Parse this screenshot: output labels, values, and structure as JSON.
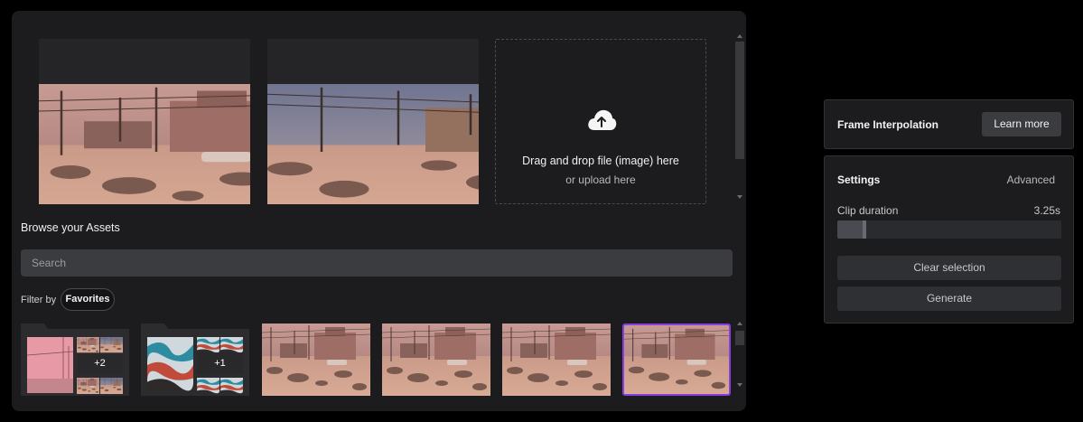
{
  "upload": {
    "title": "Drag and drop file (image) here",
    "subtitle": "or upload here",
    "icon": "cloud-upload-icon"
  },
  "assets": {
    "title": "Browse your Assets",
    "search_placeholder": "Search",
    "filter_label": "Filter by",
    "filter_chip": "Favorites",
    "folders": [
      {
        "more_count": "+2"
      },
      {
        "more_count": "+1"
      }
    ],
    "thumbnails_count": 4,
    "selected_thumbnail_index": 3
  },
  "interpolation": {
    "title": "Frame Interpolation",
    "learn_more": "Learn more"
  },
  "settings": {
    "title": "Settings",
    "advanced": "Advanced",
    "clip_duration_label": "Clip duration",
    "clip_duration_value": "3.25s",
    "clip_duration_fraction": 0.13,
    "clear_selection": "Clear selection",
    "generate": "Generate"
  },
  "colors": {
    "selected_border": "#8b3ee0",
    "panel_bg": "#1c1c1e",
    "button_bg": "#3b3c40"
  }
}
